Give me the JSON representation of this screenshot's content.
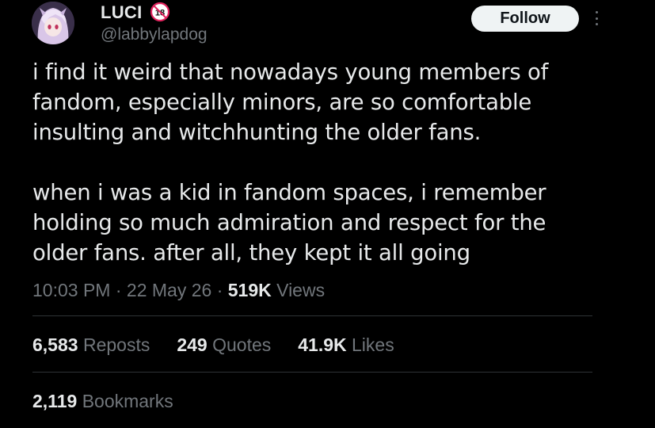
{
  "author": {
    "display_name": "LUCI",
    "handle": "@labbylapdog",
    "avatar_icon": "anime-character-avatar",
    "badge_icon": "age-18-badge-icon"
  },
  "actions": {
    "follow_label": "Follow",
    "more_icon": "more-vertical-icon"
  },
  "tweet": {
    "text": "i find it weird that nowadays young members of\nfandom, especially minors, are so comfortable\ninsulting and witchhunting the older fans.\n\nwhen i was a kid in fandom spaces, i remember\nholding so much admiration and respect for the\nolder fans. after all, they kept it all going"
  },
  "meta": {
    "time": "10:03 PM",
    "separator": "·",
    "date": "22 May 26",
    "views_count": "519K",
    "views_label": "Views"
  },
  "stats": {
    "reposts_count": "6,583",
    "reposts_label": "Reposts",
    "quotes_count": "249",
    "quotes_label": "Quotes",
    "likes_count": "41.9K",
    "likes_label": "Likes",
    "bookmarks_count": "2,119",
    "bookmarks_label": "Bookmarks"
  },
  "colors": {
    "background": "#000000",
    "primary_text": "#e7e9ea",
    "secondary_text": "#71767b",
    "divider": "#2f3336",
    "follow_bg": "#eff3f4",
    "badge_red": "#e0245e"
  }
}
